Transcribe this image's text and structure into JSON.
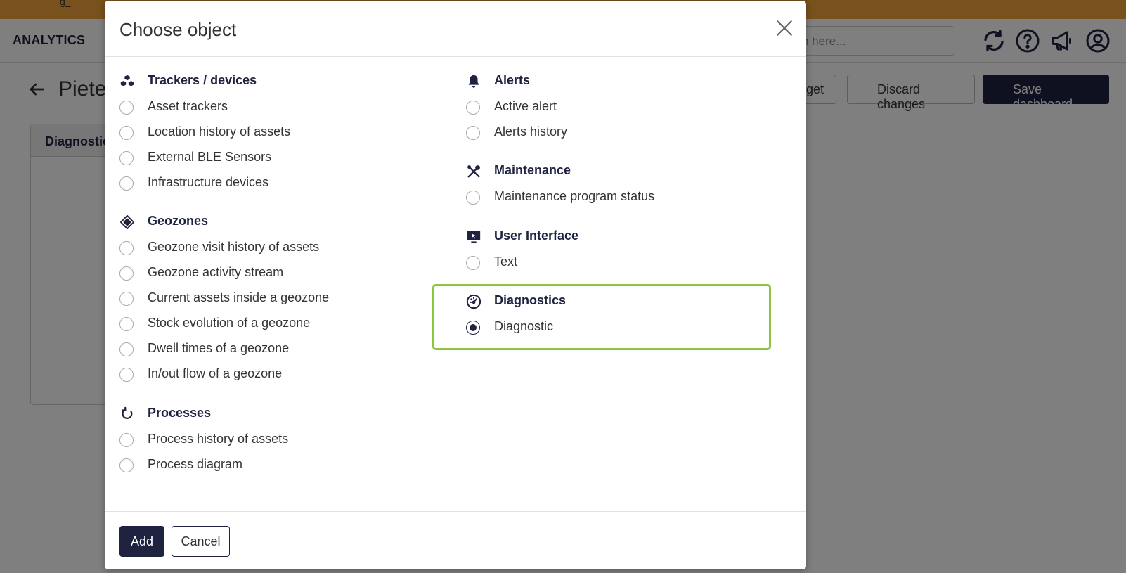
{
  "background": {
    "brand": "ANALYTICS",
    "topbar_text": "g_",
    "search_placeholder": "h here...",
    "page_title": "Pieter",
    "buttons": {
      "add_widget": "dget",
      "discard": "Discard changes",
      "save": "Save dashboard"
    },
    "widget_title": "Diagnostic"
  },
  "modal": {
    "title": "Choose object",
    "left_groups": [
      {
        "icon": "cubes-icon",
        "title": "Trackers / devices",
        "options": [
          "Asset trackers",
          "Location history of assets",
          "External BLE Sensors",
          "Infrastructure devices"
        ]
      },
      {
        "icon": "geozone-icon",
        "title": "Geozones",
        "options": [
          "Geozone visit history of assets",
          "Geozone activity stream",
          "Current assets inside a geozone",
          "Stock evolution of a geozone",
          "Dwell times of a geozone",
          "In/out flow of a geozone"
        ]
      },
      {
        "icon": "process-icon",
        "title": "Processes",
        "options": [
          "Process history of assets",
          "Process diagram"
        ]
      }
    ],
    "right_groups": [
      {
        "icon": "bell-icon",
        "title": "Alerts",
        "options": [
          "Active alert",
          "Alerts history"
        ]
      },
      {
        "icon": "tools-icon",
        "title": "Maintenance",
        "options": [
          "Maintenance program status"
        ]
      },
      {
        "icon": "monitor-icon",
        "title": "User Interface",
        "options": [
          "Text"
        ]
      },
      {
        "icon": "gauge-icon",
        "title": "Diagnostics",
        "options": [
          "Diagnostic"
        ]
      }
    ],
    "selected_option": "Diagnostic",
    "add_label": "Add",
    "cancel_label": "Cancel"
  },
  "colors": {
    "brand": "#1f2340",
    "topbar": "#f0a23a",
    "highlight": "#8cc63f"
  }
}
